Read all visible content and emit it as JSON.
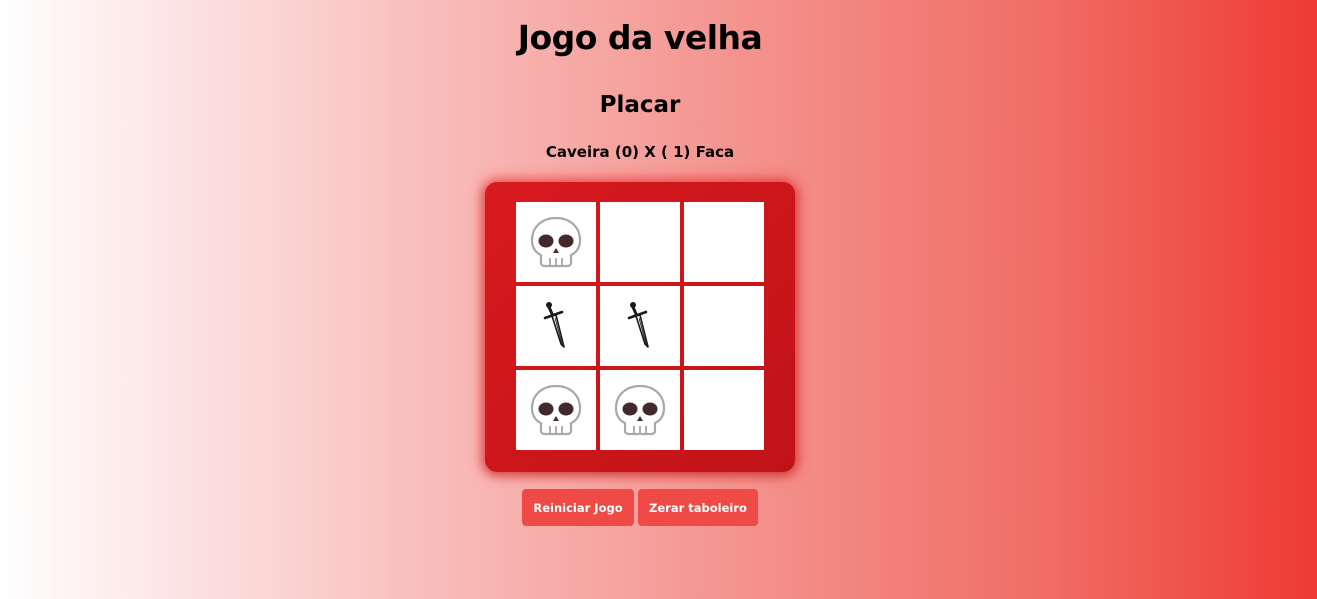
{
  "title": "Jogo da velha",
  "scoreboard": {
    "heading": "Placar",
    "text": "Caveira (0) X ( 1) Faca"
  },
  "board": {
    "cells": [
      "skull",
      "",
      "",
      "dagger",
      "dagger",
      "",
      "skull",
      "skull",
      ""
    ]
  },
  "buttons": {
    "restart": "Reiniciar Jogo",
    "reset": "Zerar taboleiro"
  },
  "colors": {
    "board": "#d81a1f",
    "button": "#f04a46",
    "cell": "#ffffff"
  }
}
